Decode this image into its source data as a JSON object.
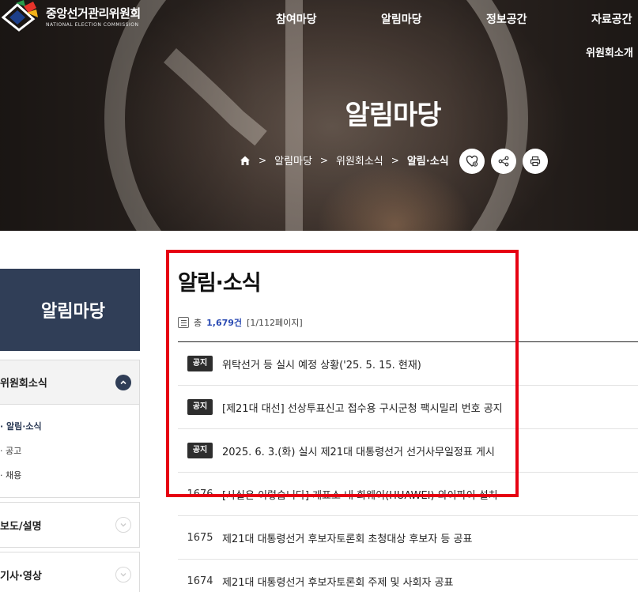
{
  "site": {
    "name_ko": "중앙선거관리위원회",
    "name_en": "NATIONAL ELECTION COMMISSION"
  },
  "gnb": [
    "참여마당",
    "알림마당",
    "정보공간",
    "자료공간"
  ],
  "gnb_sub": "위원회소개",
  "hero": {
    "title": "알림마당",
    "breadcrumb": [
      "알림마당",
      "위원회소식",
      "알림·소식"
    ]
  },
  "sidebar": {
    "title": "알림마당",
    "groups": [
      {
        "label": "위원회소식",
        "open": true,
        "items": [
          "알림·소식",
          "공고",
          "채용"
        ],
        "active": 0
      },
      {
        "label": "보도/설명",
        "open": false
      },
      {
        "label": "기사·영상",
        "open": false
      }
    ]
  },
  "main": {
    "title": "알림·소식",
    "count_prefix": "총",
    "count_total": "1,679건",
    "count_pages": "[1/112페이지]",
    "rows": [
      {
        "num": "",
        "badge": "공지",
        "title": "위탁선거 등 실시 예정 상황('25. 5. 15. 현재)"
      },
      {
        "num": "",
        "badge": "공지",
        "title": "[제21대 대선] 선상투표신고 접수용 구시군청 팩시밀리 번호 공지"
      },
      {
        "num": "",
        "badge": "공지",
        "title": "2025. 6. 3.(화) 실시 제21대 대통령선거 선거사무일정표 게시"
      },
      {
        "num": "1676",
        "badge": "",
        "title": "[사실은 이렇습니다] 개표소 내 화웨이(HUAWEI) 와이파이 설치"
      },
      {
        "num": "1675",
        "badge": "",
        "title": "제21대 대통령선거 후보자토론회 초청대상 후보자 등 공표"
      },
      {
        "num": "1674",
        "badge": "",
        "title": "제21대 대통령선거 후보자토론회 주제 및 사회자 공표"
      }
    ]
  },
  "colors": {
    "sidebar_head": "#303e57",
    "badge": "#2d2d2d",
    "count_accent": "#2b4bb3",
    "highlight": "#e60012"
  },
  "icons": {
    "home": "home-icon",
    "share": "share-icon",
    "print": "print-icon",
    "favorite": "favorite-icon"
  }
}
